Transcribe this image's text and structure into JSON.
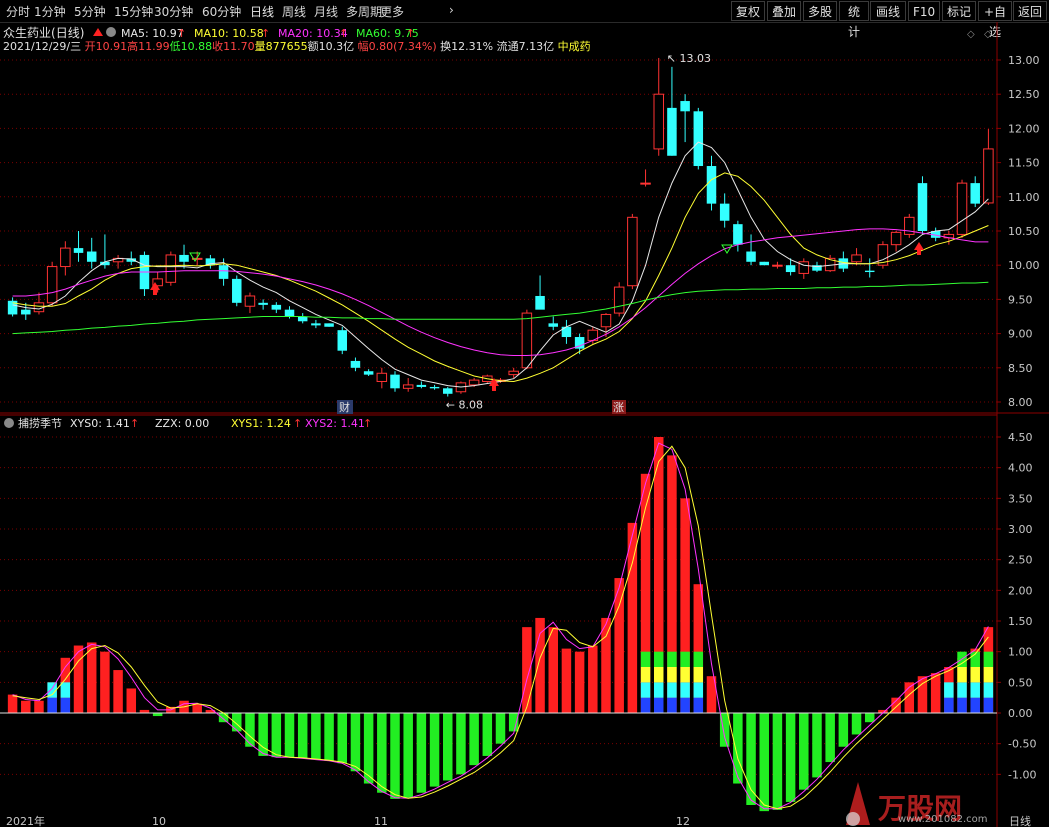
{
  "toolbar": {
    "periods": [
      "分时",
      "1分钟",
      "5分钟",
      "15分钟",
      "30分钟",
      "60分钟",
      "日线",
      "周线",
      "月线",
      "多周期",
      "更多"
    ],
    "active": "日线",
    "more_chevron": "›",
    "right_buttons": [
      "复权",
      "叠加",
      "多股",
      "统计",
      "画线",
      "F10",
      "标记",
      "+自选",
      "返回"
    ]
  },
  "stock": {
    "name": "众生药业",
    "period_label": "(日线)",
    "date": "2021/12/29/三",
    "open_label": "开",
    "open": "10.91",
    "high_label": "高",
    "high": "11.99",
    "low_label": "低",
    "low": "10.88",
    "close_label": "收",
    "close": "11.70",
    "volume_label": "量",
    "volume": "877655",
    "amount_label": "额",
    "amount": "10.3亿",
    "change_label": "幅",
    "change": "0.80(7.34%)",
    "turnover": "换12.31%",
    "float_cap": "流通7.13亿",
    "sector": "中成药"
  },
  "ma_legend": [
    {
      "label": "MA5: 10.97",
      "color": "#e8e8e8"
    },
    {
      "label": "MA10: 10.58",
      "color": "#ffff33"
    },
    {
      "label": "MA20: 10.34",
      "color": "#ff33ff"
    },
    {
      "label": "MA60: 9.75",
      "color": "#33ff33"
    }
  ],
  "indicator": {
    "name": "捕捞季节",
    "legend": [
      {
        "label": "XYS0: 1.41",
        "color": "#e8e8e8"
      },
      {
        "label": "ZZX: 0.00",
        "color": "#e8e8e8"
      },
      {
        "label": "XYS1: 1.24",
        "color": "#ffff33"
      },
      {
        "label": "XYS2: 1.41",
        "color": "#ff33ff"
      }
    ]
  },
  "markers": {
    "high_label": "13.03",
    "low_label": "8.08",
    "cai": "财",
    "zhang": "涨"
  },
  "bottom_labels": [
    "2021年",
    "10",
    "11",
    "12",
    "日线"
  ],
  "watermark": {
    "brand": "万股网",
    "url": "www.201082.com"
  },
  "colors": {
    "up": "#ff3333",
    "down": "#33ffff",
    "ma5": "#e8e8e8",
    "ma10": "#ffff33",
    "ma20": "#ff33ff",
    "ma60": "#33ff33",
    "grid": "#7a0000",
    "axis_text": "#c8c8c8"
  },
  "chart_data": [
    {
      "type": "candlestick",
      "title": "众生药业(日线)",
      "ylim": [
        7.85,
        13.2
      ],
      "yticks": [
        8.0,
        8.5,
        9.0,
        9.5,
        10.0,
        10.5,
        11.0,
        11.5,
        12.0,
        12.5,
        13.0
      ],
      "ohlc": [
        [
          9.48,
          9.53,
          9.25,
          9.28
        ],
        [
          9.35,
          9.45,
          9.2,
          9.28
        ],
        [
          9.32,
          9.6,
          9.28,
          9.45
        ],
        [
          9.45,
          10.05,
          9.4,
          9.98
        ],
        [
          9.98,
          10.35,
          9.85,
          10.25
        ],
        [
          10.25,
          10.5,
          10.05,
          10.18
        ],
        [
          10.2,
          10.4,
          9.95,
          10.05
        ],
        [
          10.05,
          10.45,
          9.95,
          10.0
        ],
        [
          10.05,
          10.15,
          9.95,
          10.1
        ],
        [
          10.1,
          10.2,
          10.0,
          10.05
        ],
        [
          10.15,
          10.2,
          9.55,
          9.65
        ],
        [
          9.7,
          9.9,
          9.6,
          9.8
        ],
        [
          9.75,
          10.2,
          9.7,
          10.15
        ],
        [
          10.15,
          10.3,
          9.95,
          10.05
        ],
        [
          10.1,
          10.2,
          10.0,
          10.1
        ],
        [
          10.1,
          10.15,
          9.95,
          10.0
        ],
        [
          10.0,
          10.1,
          9.7,
          9.8
        ],
        [
          9.8,
          9.85,
          9.4,
          9.45
        ],
        [
          9.4,
          9.6,
          9.3,
          9.55
        ],
        [
          9.45,
          9.5,
          9.35,
          9.42
        ],
        [
          9.42,
          9.46,
          9.3,
          9.35
        ],
        [
          9.35,
          9.4,
          9.22,
          9.25
        ],
        [
          9.25,
          9.3,
          9.15,
          9.18
        ],
        [
          9.15,
          9.2,
          9.08,
          9.12
        ],
        [
          9.15,
          9.15,
          9.1,
          9.1
        ],
        [
          9.05,
          9.1,
          8.7,
          8.75
        ],
        [
          8.6,
          8.65,
          8.45,
          8.5
        ],
        [
          8.45,
          8.48,
          8.38,
          8.4
        ],
        [
          8.3,
          8.5,
          8.2,
          8.42
        ],
        [
          8.4,
          8.45,
          8.15,
          8.2
        ],
        [
          8.2,
          8.35,
          8.15,
          8.25
        ],
        [
          8.25,
          8.3,
          8.2,
          8.22
        ],
        [
          8.22,
          8.25,
          8.18,
          8.2
        ],
        [
          8.2,
          8.22,
          8.08,
          8.12
        ],
        [
          8.15,
          8.3,
          8.12,
          8.28
        ],
        [
          8.25,
          8.35,
          8.22,
          8.32
        ],
        [
          8.3,
          8.4,
          8.28,
          8.38
        ],
        [
          8.3,
          8.35,
          8.28,
          8.32
        ],
        [
          8.4,
          8.5,
          8.35,
          8.45
        ],
        [
          8.5,
          9.35,
          8.48,
          9.3
        ],
        [
          9.55,
          9.85,
          9.45,
          9.35
        ],
        [
          9.15,
          9.25,
          9.05,
          9.1
        ],
        [
          9.1,
          9.2,
          8.85,
          8.95
        ],
        [
          8.95,
          9.0,
          8.7,
          8.78
        ],
        [
          8.9,
          9.1,
          8.85,
          9.05
        ],
        [
          9.1,
          9.3,
          8.95,
          9.28
        ],
        [
          9.3,
          9.75,
          9.25,
          9.68
        ],
        [
          9.7,
          10.75,
          9.65,
          10.7
        ],
        [
          11.2,
          11.4,
          11.15,
          11.2
        ],
        [
          11.7,
          13.03,
          11.6,
          12.5
        ],
        [
          12.3,
          12.9,
          11.6,
          11.6
        ],
        [
          12.4,
          12.5,
          11.8,
          12.25
        ],
        [
          12.25,
          12.3,
          11.4,
          11.45
        ],
        [
          11.45,
          11.6,
          10.8,
          10.9
        ],
        [
          10.9,
          11.05,
          10.55,
          10.65
        ],
        [
          10.6,
          10.65,
          10.2,
          10.3
        ],
        [
          10.2,
          10.45,
          10.0,
          10.05
        ],
        [
          10.05,
          10.05,
          10.0,
          10.0
        ],
        [
          10.0,
          10.05,
          9.95,
          10.0
        ],
        [
          10.0,
          10.1,
          9.85,
          9.9
        ],
        [
          9.88,
          10.1,
          9.8,
          10.05
        ],
        [
          10.0,
          10.05,
          9.9,
          9.92
        ],
        [
          9.92,
          10.15,
          9.9,
          10.1
        ],
        [
          10.1,
          10.2,
          9.9,
          9.95
        ],
        [
          10.05,
          10.25,
          10.0,
          10.15
        ],
        [
          9.92,
          10.1,
          9.82,
          9.9
        ],
        [
          10.0,
          10.35,
          9.95,
          10.3
        ],
        [
          10.3,
          10.5,
          10.2,
          10.48
        ],
        [
          10.45,
          10.75,
          10.4,
          10.7
        ],
        [
          11.2,
          11.3,
          10.45,
          10.5
        ],
        [
          10.5,
          10.55,
          10.35,
          10.4
        ],
        [
          10.4,
          10.5,
          10.3,
          10.45
        ],
        [
          10.45,
          11.25,
          10.4,
          11.2
        ],
        [
          11.2,
          11.3,
          10.85,
          10.9
        ],
        [
          10.91,
          11.99,
          10.88,
          11.7
        ]
      ],
      "series": [
        {
          "name": "MA5",
          "values": [
            9.42,
            9.38,
            9.36,
            9.43,
            9.55,
            9.75,
            9.92,
            10.05,
            10.1,
            10.09,
            10.0,
            9.98,
            9.98,
            9.98,
            9.96,
            10.02,
            10.04,
            9.9,
            9.78,
            9.68,
            9.6,
            9.48,
            9.38,
            9.28,
            9.2,
            9.12,
            8.95,
            8.78,
            8.62,
            8.48,
            8.4,
            8.32,
            8.28,
            8.24,
            8.22,
            8.24,
            8.27,
            8.3,
            8.34,
            8.5,
            8.75,
            8.98,
            9.1,
            9.18,
            9.1,
            9.02,
            9.14,
            9.48,
            10.0,
            10.7,
            11.2,
            11.6,
            11.8,
            11.72,
            11.5,
            11.1,
            10.7,
            10.38,
            10.2,
            10.08,
            10.0,
            9.98,
            10.0,
            10.02,
            10.02,
            10.02,
            10.08,
            10.18,
            10.3,
            10.45,
            10.5,
            10.52,
            10.65,
            10.78,
            10.97
          ]
        },
        {
          "name": "MA10",
          "values": [
            9.45,
            9.42,
            9.4,
            9.4,
            9.44,
            9.55,
            9.65,
            9.78,
            9.88,
            9.95,
            9.98,
            9.99,
            9.99,
            10.0,
            9.99,
            10.0,
            10.02,
            10.0,
            9.95,
            9.9,
            9.85,
            9.78,
            9.7,
            9.62,
            9.52,
            9.42,
            9.3,
            9.18,
            9.05,
            8.92,
            8.8,
            8.7,
            8.6,
            8.52,
            8.45,
            8.38,
            8.34,
            8.31,
            8.3,
            8.35,
            8.42,
            8.5,
            8.62,
            8.74,
            8.84,
            8.92,
            9.03,
            9.22,
            9.48,
            9.85,
            10.25,
            10.7,
            11.05,
            11.25,
            11.35,
            11.3,
            11.15,
            10.95,
            10.7,
            10.45,
            10.25,
            10.15,
            10.08,
            10.04,
            10.02,
            10.02,
            10.04,
            10.08,
            10.14,
            10.22,
            10.3,
            10.35,
            10.42,
            10.5,
            10.58
          ]
        },
        {
          "name": "MA20",
          "values": [
            9.55,
            9.55,
            9.57,
            9.6,
            9.65,
            9.72,
            9.78,
            9.84,
            9.88,
            9.9,
            9.9,
            9.9,
            9.91,
            9.92,
            9.92,
            9.92,
            9.92,
            9.91,
            9.89,
            9.87,
            9.84,
            9.8,
            9.76,
            9.71,
            9.65,
            9.58,
            9.5,
            9.41,
            9.31,
            9.21,
            9.11,
            9.02,
            8.94,
            8.87,
            8.81,
            8.76,
            8.72,
            8.69,
            8.68,
            8.68,
            8.69,
            8.72,
            8.76,
            8.82,
            8.9,
            8.99,
            9.1,
            9.23,
            9.38,
            9.55,
            9.72,
            9.88,
            10.02,
            10.14,
            10.24,
            10.3,
            10.34,
            10.37,
            10.4,
            10.42,
            10.44,
            10.46,
            10.48,
            10.5,
            10.52,
            10.53,
            10.53,
            10.52,
            10.5,
            10.47,
            10.44,
            10.4,
            10.37,
            10.34,
            10.34
          ]
        },
        {
          "name": "MA60",
          "values": [
            9.0,
            9.01,
            9.02,
            9.03,
            9.05,
            9.06,
            9.08,
            9.09,
            9.11,
            9.12,
            9.14,
            9.15,
            9.17,
            9.18,
            9.2,
            9.21,
            9.22,
            9.23,
            9.24,
            9.25,
            9.25,
            9.25,
            9.25,
            9.24,
            9.24,
            9.23,
            9.23,
            9.22,
            9.22,
            9.21,
            9.21,
            9.21,
            9.21,
            9.21,
            9.21,
            9.21,
            9.21,
            9.21,
            9.21,
            9.22,
            9.24,
            9.26,
            9.28,
            9.3,
            9.33,
            9.36,
            9.4,
            9.44,
            9.49,
            9.53,
            9.57,
            9.6,
            9.62,
            9.63,
            9.64,
            9.64,
            9.65,
            9.65,
            9.66,
            9.66,
            9.66,
            9.67,
            9.67,
            9.68,
            9.68,
            9.69,
            9.69,
            9.7,
            9.71,
            9.71,
            9.72,
            9.73,
            9.74,
            9.74,
            9.75
          ]
        }
      ]
    },
    {
      "type": "bar",
      "title": "捕捞季节",
      "ylim": [
        -1.45,
        4.7
      ],
      "yticks": [
        -1.0,
        -0.5,
        0.0,
        0.5,
        1.0,
        1.5,
        2.0,
        2.5,
        3.0,
        3.5,
        4.0,
        4.5
      ],
      "values": [
        0.3,
        0.2,
        0.2,
        0.5,
        0.9,
        1.1,
        1.15,
        1.0,
        0.7,
        0.4,
        0.05,
        -0.05,
        0.1,
        0.2,
        0.15,
        0.05,
        -0.15,
        -0.3,
        -0.55,
        -0.7,
        -0.72,
        -0.72,
        -0.74,
        -0.76,
        -0.78,
        -0.82,
        -0.95,
        -1.15,
        -1.3,
        -1.4,
        -1.38,
        -1.3,
        -1.2,
        -1.1,
        -1.0,
        -0.85,
        -0.7,
        -0.5,
        -0.3,
        1.4,
        1.55,
        1.4,
        1.05,
        1.0,
        1.1,
        1.55,
        2.2,
        3.1,
        3.9,
        4.5,
        4.2,
        3.5,
        2.1,
        0.6,
        -0.55,
        -1.15,
        -1.5,
        -1.6,
        -1.58,
        -1.45,
        -1.25,
        -1.05,
        -0.8,
        -0.55,
        -0.35,
        -0.15,
        0.05,
        0.25,
        0.5,
        0.6,
        0.65,
        0.75,
        0.9,
        1.05,
        1.4
      ],
      "series": [
        {
          "name": "XYS0",
          "values": [
            0.3,
            0.22,
            0.2,
            0.4,
            0.75,
            1.0,
            1.12,
            1.08,
            0.88,
            0.58,
            0.25,
            0.05,
            0.05,
            0.15,
            0.16,
            0.08,
            -0.1,
            -0.28,
            -0.5,
            -0.66,
            -0.72,
            -0.72,
            -0.74,
            -0.76,
            -0.78,
            -0.82,
            -0.93,
            -1.12,
            -1.28,
            -1.38,
            -1.39,
            -1.33,
            -1.24,
            -1.13,
            -1.03,
            -0.89,
            -0.73,
            -0.54,
            -0.33,
            0.55,
            1.3,
            1.48,
            1.2,
            1.05,
            1.08,
            1.45,
            2.05,
            2.9,
            3.75,
            4.4,
            4.3,
            3.65,
            2.35,
            0.8,
            -0.4,
            -1.05,
            -1.42,
            -1.56,
            -1.56,
            -1.46,
            -1.28,
            -1.08,
            -0.84,
            -0.6,
            -0.4,
            -0.2,
            0.0,
            0.2,
            0.42,
            0.56,
            0.64,
            0.74,
            0.88,
            1.03,
            1.41
          ]
        },
        {
          "name": "XYS1",
          "values": [
            0.28,
            0.25,
            0.22,
            0.3,
            0.55,
            0.85,
            1.05,
            1.1,
            0.98,
            0.75,
            0.45,
            0.18,
            0.08,
            0.1,
            0.15,
            0.12,
            0.0,
            -0.18,
            -0.38,
            -0.56,
            -0.68,
            -0.72,
            -0.73,
            -0.75,
            -0.77,
            -0.8,
            -0.87,
            -1.02,
            -1.2,
            -1.33,
            -1.39,
            -1.37,
            -1.29,
            -1.19,
            -1.08,
            -0.97,
            -0.82,
            -0.65,
            -0.45,
            0.1,
            0.9,
            1.38,
            1.35,
            1.15,
            1.08,
            1.25,
            1.75,
            2.45,
            3.35,
            4.1,
            4.35,
            4.0,
            3.05,
            1.6,
            0.2,
            -0.75,
            -1.25,
            -1.5,
            -1.56,
            -1.52,
            -1.38,
            -1.18,
            -0.96,
            -0.72,
            -0.5,
            -0.3,
            -0.1,
            0.1,
            0.3,
            0.48,
            0.6,
            0.69,
            0.81,
            0.96,
            1.24
          ]
        }
      ]
    }
  ]
}
